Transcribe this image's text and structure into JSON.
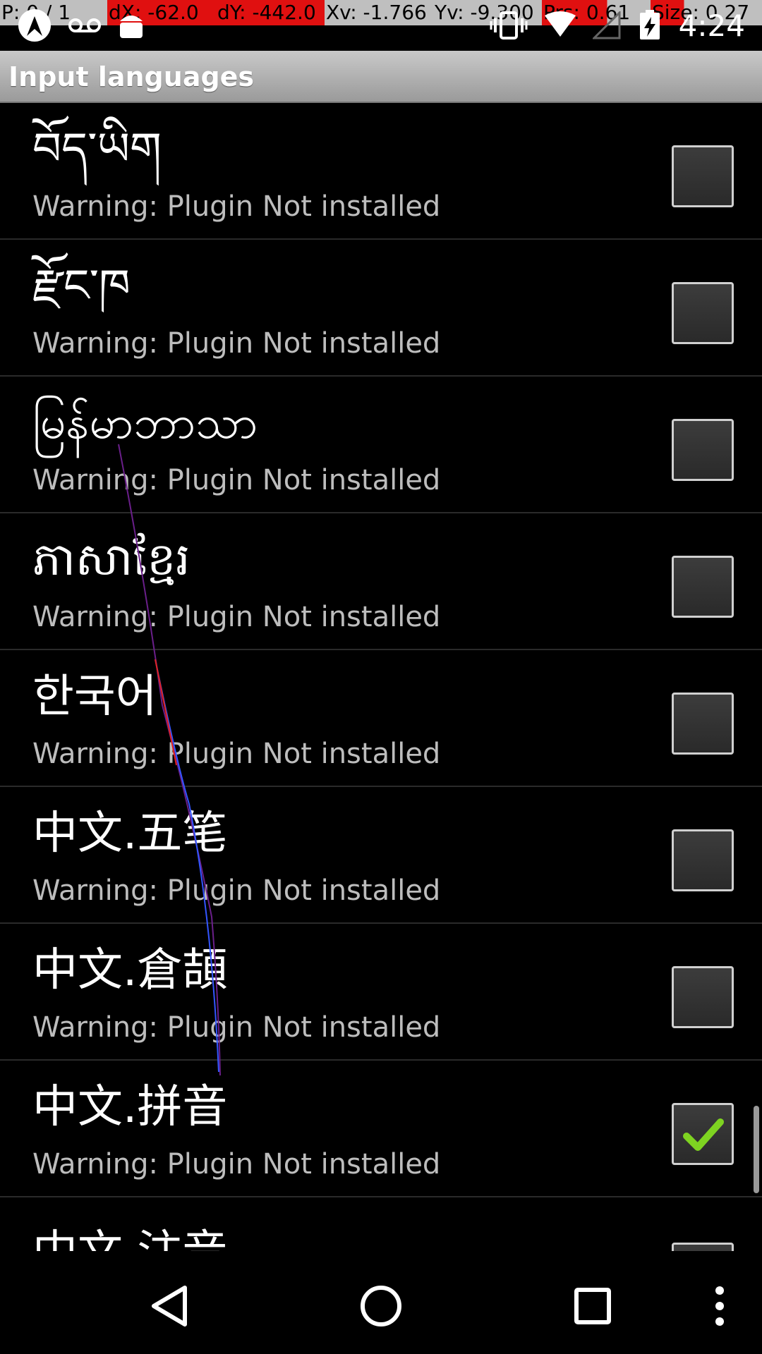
{
  "debug": {
    "pointer": "P: 0 / 1",
    "dx": "dX: -62.0",
    "dy": "dY: -442.0",
    "xv": "Xv: -1.766",
    "yv": "Yv: -9.300",
    "prs": "Prs: 0.61",
    "size": "Size: 0.27"
  },
  "status_bar": {
    "time": "4:24",
    "left_icons": [
      "pointer-app-icon",
      "voicemail-icon",
      "android-icon"
    ],
    "right_icons": [
      "vibrate-icon",
      "wifi-icon",
      "signal-icon",
      "battery-charging-icon"
    ]
  },
  "title_bar": {
    "title": "Input languages"
  },
  "languages": [
    {
      "title": "བོད་ཡིག",
      "summary": "Warning: Plugin Not installed",
      "checked": false
    },
    {
      "title": "རྫོང་ཁ",
      "summary": "Warning: Plugin Not installed",
      "checked": false
    },
    {
      "title": "မြန်မာဘာသာ",
      "summary": "Warning: Plugin Not installed",
      "checked": false
    },
    {
      "title": "ភាសាខ្មែរ",
      "summary": "Warning: Plugin Not installed",
      "checked": false
    },
    {
      "title": "한국어",
      "summary": "Warning: Plugin Not installed",
      "checked": false
    },
    {
      "title": "中文.五笔",
      "summary": "Warning: Plugin Not installed",
      "checked": false
    },
    {
      "title": "中文.倉頡",
      "summary": "Warning: Plugin Not installed",
      "checked": false
    },
    {
      "title": "中文.拼音",
      "summary": "Warning: Plugin Not installed",
      "checked": true
    },
    {
      "title": "中文.注音",
      "summary": "",
      "checked": false
    }
  ],
  "colors": {
    "debug_red": "#e01010",
    "debug_gray": "#bfbfbf",
    "check_green": "#7ed321"
  },
  "nav_bar": {
    "buttons": [
      "back-icon",
      "home-icon",
      "recents-icon",
      "overflow-menu-icon"
    ]
  }
}
